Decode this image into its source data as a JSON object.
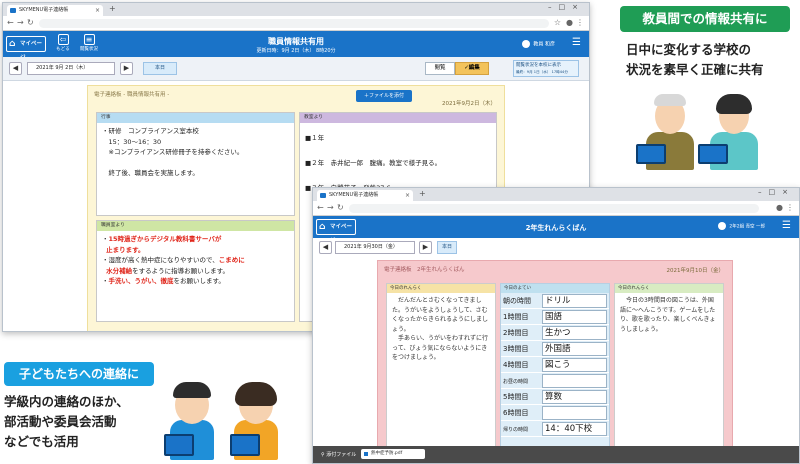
{
  "teacher_window": {
    "tab_title": "SKYMENU電子連絡帳",
    "app_home": "マイページ",
    "nav": [
      "もどる",
      "閲覧状況"
    ],
    "title": "職員情報共有用",
    "subtitle": "更新日時：9月 2日（木） 8時20分",
    "user": "教員 和彦",
    "date": "2021年 9月 2日（木）",
    "today": "本日",
    "toggle": [
      "閲覧",
      "編集"
    ],
    "read_status": "閲覧状況を本校に表示",
    "read_status_sub": "最終：9月 1日（水） 17時44分",
    "board_title": "電子連絡板 - 職員情報共有用 -",
    "add_file": "＋ファイルを添付",
    "board_date": "2021年9月2日（木）",
    "panels": {
      "events": {
        "title": "行事",
        "text": "・研修　コンプライアンス室本校\n　15：30～16：30\n　※コンプライアンス研修冊子を持参ください。\n\n　終了後、職員会を実施します。"
      },
      "from_teachers": {
        "title": "教室より",
        "lines": [
          "■１年",
          "■２年　赤井紀一郎　腹痛。教室で様子見る。",
          "■３年　白鷺花子　発熱37.6"
        ]
      },
      "from_admin": {
        "title": "職員室より",
        "l1_red": "15時過ぎからデジタル教科書サーバが",
        "l1b_red": "止まります。",
        "l2": "湿度が高く熱中症になりやすいので、",
        "l2_red_a": "こまめに",
        "l2_red_b": "水分補給",
        "l2_tail": "をするように指導お願いします。",
        "l3_red": "手洗い、うがい、徹底",
        "l3_tail": "をお願いします。"
      }
    }
  },
  "student_window": {
    "tab_title": "SKYMENU電子連絡帳",
    "app_home": "マイページ",
    "title": "2年生れんらくばん",
    "user": "2年2組 青空 一郎",
    "date": "2021年 9月30日（金）",
    "today": "本日",
    "board_title": "電子連絡板　2年生れんらくばん",
    "board_date": "2021年9月10日（金）",
    "notice": {
      "title": "今日のれんらく",
      "text": "　だんだんとさむくなってきました。うがいをようしょうして、さむくなったからきられるようにしましょう。\n　手あらい、うがいをわすれずに行って、びょう気にならないようにきをつけましょう。"
    },
    "schedule": {
      "title": "今日のよてい",
      "rows": [
        {
          "label": "朝の時間",
          "value": "ドリル"
        },
        {
          "label": "1時間目",
          "value": "国語"
        },
        {
          "label": "2時間目",
          "value": "生かつ"
        },
        {
          "label": "3時間目",
          "value": "外国語"
        },
        {
          "label": "4時間目",
          "value": "図こう"
        },
        {
          "label": "お昼の時間",
          "value": ""
        },
        {
          "label": "5時間目",
          "value": "算数"
        },
        {
          "label": "6時間目",
          "value": ""
        },
        {
          "label": "帰りの時間",
          "value": "14：40下校"
        }
      ]
    },
    "news": {
      "title": "今日のれんらく",
      "text": "　今日の3時間目の図こうは、外国語に～へんこうです。ゲームをしたり、歌を歌ったり、楽しくべんきょうしましょう。"
    },
    "attach_label": "添付ファイル",
    "attach_file": "熱中症予防.pdf"
  },
  "callouts": {
    "top": "教員間での情報共有に",
    "top_caption": "日中に変化する学校の\n状況を素早く正確に共有",
    "bottom": "子どもたちへの連絡に",
    "bottom_caption": "学級内の連絡のほか、\n部活動や委員会活動\nなどでも活用"
  },
  "colors": {
    "accent": "#1a73c8",
    "green": "#1f9d55",
    "cyan": "#1aa0e0",
    "yellow_board": "#fdf6d6",
    "pink_board": "#f6c9cc"
  }
}
